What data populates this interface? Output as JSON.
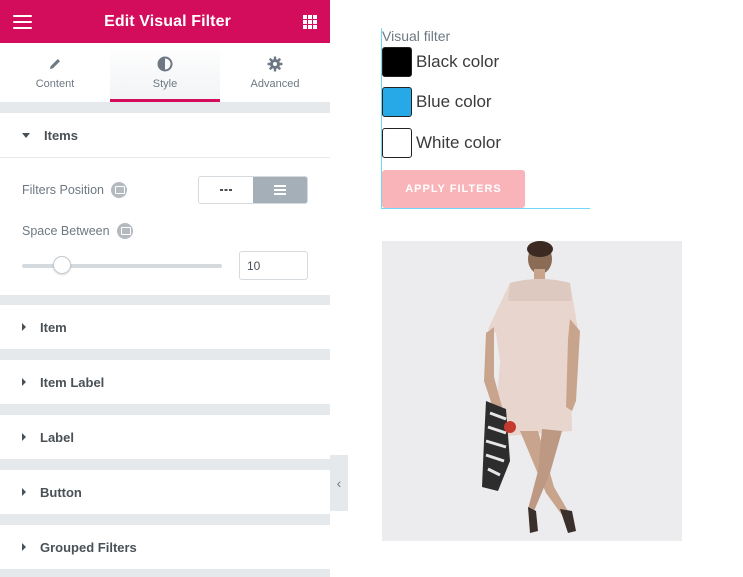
{
  "header": {
    "title": "Edit Visual Filter",
    "menu_icon": "hamburger-icon",
    "apps_icon": "grid-icon"
  },
  "tabs": [
    {
      "label": "Content",
      "icon": "pencil-icon"
    },
    {
      "label": "Style",
      "icon": "half-circle-icon",
      "active": true
    },
    {
      "label": "Advanced",
      "icon": "gear-icon"
    }
  ],
  "items_section": {
    "title": "Items",
    "filters_position_label": "Filters Position",
    "filters_position_options": [
      "inline",
      "block"
    ],
    "filters_position_selected": "block",
    "space_between_label": "Space Between",
    "space_between_value": "10",
    "space_between_fraction": 0.2
  },
  "sections": [
    "Item",
    "Item Label",
    "Label",
    "Button",
    "Grouped Filters"
  ],
  "preview": {
    "title": "Visual filter",
    "swatches": [
      {
        "label": "Black color",
        "color": "#000000"
      },
      {
        "label": "Blue color",
        "color": "#27a9e8"
      },
      {
        "label": "White color",
        "color": "#ffffff"
      }
    ],
    "apply_label": "APPLY FILTERS"
  },
  "colors": {
    "accent": "#d30c5c",
    "apply_button": "#f9b4b9"
  }
}
